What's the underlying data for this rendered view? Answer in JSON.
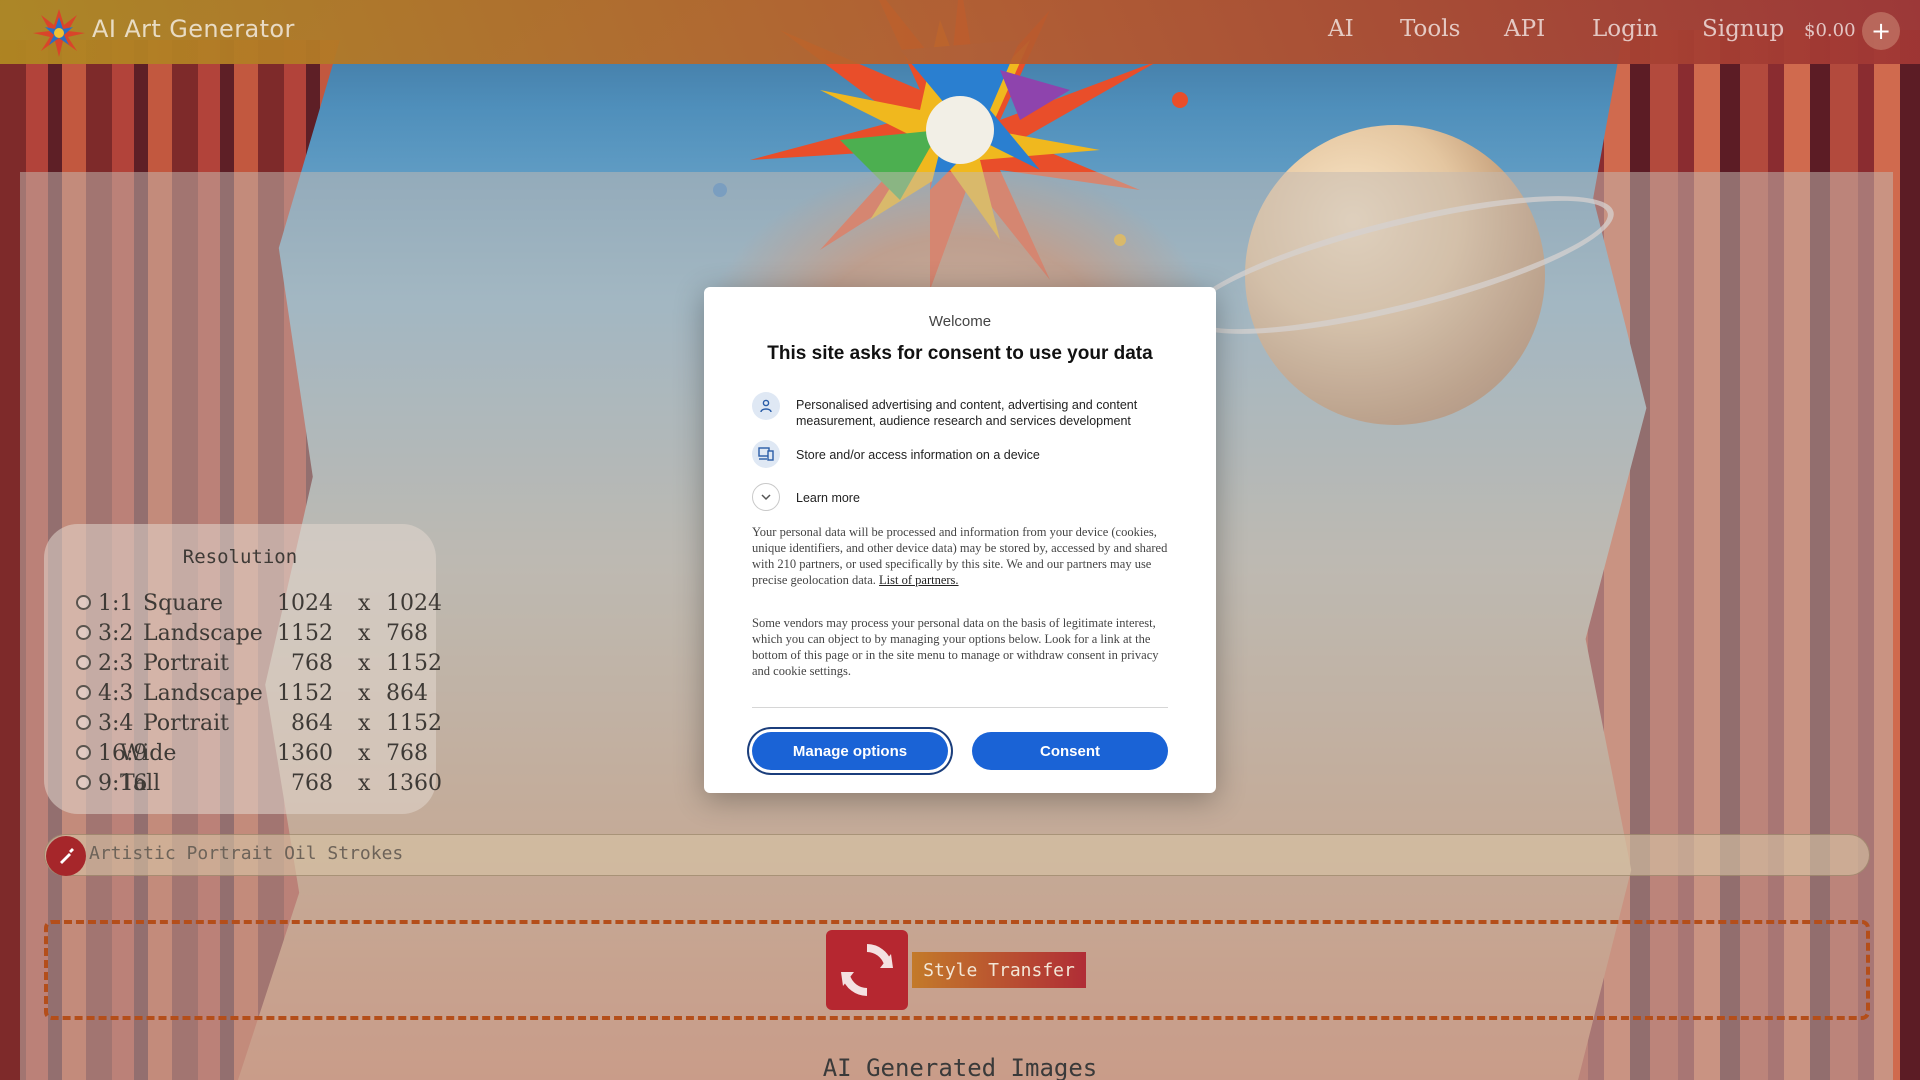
{
  "header": {
    "brand": "AI Art Generator",
    "nav": [
      "AI",
      "Tools",
      "API",
      "Login",
      "Signup"
    ],
    "balance": "$0.00",
    "plus_label": "+"
  },
  "resolution": {
    "title": "Resolution",
    "options": [
      {
        "ratio": "1:1",
        "name": "Square",
        "w": "1024",
        "x": "x",
        "h": "1024"
      },
      {
        "ratio": "3:2",
        "name": "Landscape",
        "w": "1152",
        "x": "x",
        "h": "768"
      },
      {
        "ratio": "2:3",
        "name": "Portrait",
        "w": "768",
        "x": "x",
        "h": "1152"
      },
      {
        "ratio": "4:3",
        "name": "Landscape",
        "w": "1152",
        "x": "x",
        "h": "864"
      },
      {
        "ratio": "3:4",
        "name": "Portrait",
        "w": "864",
        "x": "x",
        "h": "1152"
      },
      {
        "ratio": "16:9",
        "name": "Wide",
        "w": "1360",
        "x": "x",
        "h": "768"
      },
      {
        "ratio": "9:16",
        "name": "Tall",
        "w": "768",
        "x": "x",
        "h": "1360"
      }
    ]
  },
  "prompt": {
    "value": "Artistic Portrait Oil Strokes"
  },
  "actions": {
    "style_transfer": "Style Transfer"
  },
  "gallery": {
    "title": "AI Generated Images"
  },
  "consent": {
    "welcome": "Welcome",
    "title": "This site asks for consent to use your data",
    "purposes": [
      {
        "icon": "person-icon",
        "text": "Personalised advertising and content, advertising and content measurement, audience research and services development"
      },
      {
        "icon": "devices-icon",
        "text": "Store and/or access information on a device"
      }
    ],
    "learn_more": "Learn more",
    "paragraph1": "Your personal data will be processed and information from your device (cookies, unique identifiers, and other device data) may be stored by, accessed by and shared with 210 partners, or used specifically by this site. We and our partners may use precise geolocation data.",
    "partners_link": "List of partners.",
    "paragraph2": "Some vendors may process your personal data on the basis of legitimate interest, which you can object to by managing your options below. Look for a link at the bottom of this page or in the site menu to manage or withdraw consent in privacy and cookie settings.",
    "manage_button": "Manage options",
    "consent_button": "Consent"
  },
  "colors": {
    "primary_button": "#1a63d6",
    "accent_red": "#b62730",
    "dash_border": "#b44e1a"
  }
}
